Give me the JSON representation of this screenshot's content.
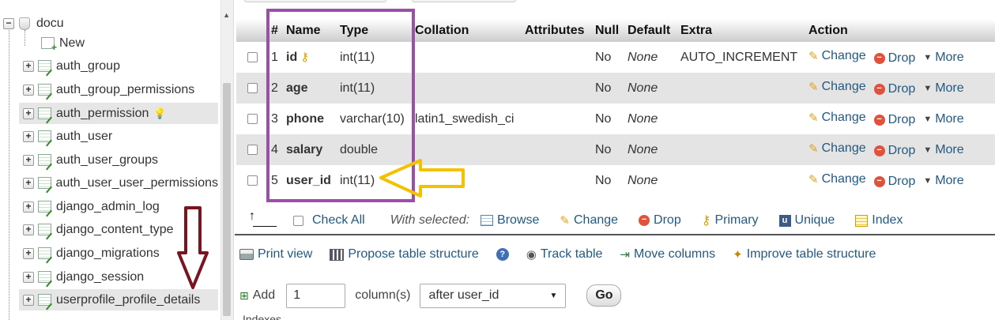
{
  "nav": {
    "database": "docu",
    "new_label": "New",
    "tables": [
      "auth_group",
      "auth_group_permissions",
      "auth_permission",
      "auth_user",
      "auth_user_groups",
      "auth_user_user_permissions",
      "django_admin_log",
      "django_content_type",
      "django_migrations",
      "django_session",
      "userprofile_profile_details"
    ]
  },
  "structure": {
    "headers": {
      "num": "#",
      "name": "Name",
      "type": "Type",
      "collation": "Collation",
      "attributes": "Attributes",
      "null": "Null",
      "default": "Default",
      "extra": "Extra",
      "action": "Action"
    },
    "rows": [
      {
        "num": "1",
        "name": "id",
        "type": "int(11)",
        "collation": "",
        "attributes": "",
        "null": "No",
        "default": "None",
        "extra": "AUTO_INCREMENT"
      },
      {
        "num": "2",
        "name": "age",
        "type": "int(11)",
        "collation": "",
        "attributes": "",
        "null": "No",
        "default": "None",
        "extra": ""
      },
      {
        "num": "3",
        "name": "phone",
        "type": "varchar(10)",
        "collation": "latin1_swedish_ci",
        "attributes": "",
        "null": "No",
        "default": "None",
        "extra": ""
      },
      {
        "num": "4",
        "name": "salary",
        "type": "double",
        "collation": "",
        "attributes": "",
        "null": "No",
        "default": "None",
        "extra": ""
      },
      {
        "num": "5",
        "name": "user_id",
        "type": "int(11)",
        "collation": "",
        "attributes": "",
        "null": "No",
        "default": "None",
        "extra": ""
      }
    ],
    "actions": {
      "change": "Change",
      "drop": "Drop",
      "more": "More"
    }
  },
  "bulk": {
    "check_all": "Check All",
    "with_selected": "With selected:",
    "browse": "Browse",
    "change": "Change",
    "drop": "Drop",
    "primary": "Primary",
    "unique": "Unique",
    "index": "Index"
  },
  "toolbar": {
    "print_view": "Print view",
    "propose": "Propose table structure",
    "track": "Track table",
    "move": "Move columns",
    "improve": "Improve table structure"
  },
  "add": {
    "label": "Add",
    "count": "1",
    "columns_label": "column(s)",
    "position": "after user_id",
    "go": "Go",
    "indexes_cut": "Indexes"
  },
  "annotation_colors": {
    "box": "#9b4fa8",
    "yellow_arrow": "#f2c200",
    "red_arrow": "#7a1420"
  }
}
